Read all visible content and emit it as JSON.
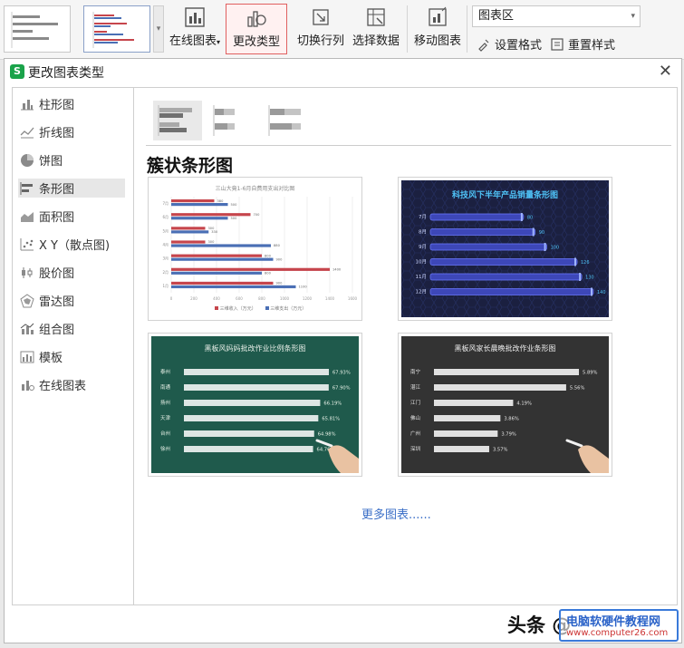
{
  "ribbon": {
    "online_chart": "在线图表",
    "change_type": "更改类型",
    "switch_row_col": "切换行列",
    "select_data": "选择数据",
    "move_chart": "移动图表",
    "chart_area_value": "图表区",
    "set_format": "设置格式",
    "reset_style": "重置样式",
    "dropdown_arrow": "▾"
  },
  "dialog": {
    "title": "更改图表类型",
    "close": "✕",
    "sidebar": [
      {
        "label": "柱形图",
        "icon": "column-chart-icon"
      },
      {
        "label": "折线图",
        "icon": "line-chart-icon"
      },
      {
        "label": "饼图",
        "icon": "pie-chart-icon"
      },
      {
        "label": "条形图",
        "icon": "bar-chart-icon"
      },
      {
        "label": "面积图",
        "icon": "area-chart-icon"
      },
      {
        "label": "X Y（散点图)",
        "icon": "scatter-chart-icon"
      },
      {
        "label": "股价图",
        "icon": "stock-chart-icon"
      },
      {
        "label": "雷达图",
        "icon": "radar-chart-icon"
      },
      {
        "label": "组合图",
        "icon": "combo-chart-icon"
      },
      {
        "label": "模板",
        "icon": "template-icon"
      },
      {
        "label": "在线图表",
        "icon": "online-chart-icon"
      }
    ],
    "selected_index": 3,
    "section_title": "簇状条形图",
    "more_charts": "更多图表......",
    "templates": [
      {
        "title": "三山大竟1-6月自费用支出对比图",
        "categories": [
          "1月",
          "2月",
          "3月",
          "4月",
          "5月",
          "6月",
          "7月"
        ],
        "series": [
          {
            "name": "三维收入（万元）",
            "color": "#c6454c",
            "values": [
              900,
              1400,
              800,
              300,
              300,
              700,
              380
            ]
          },
          {
            "name": "三维支出（万元）",
            "color": "#4a6fb5",
            "values": [
              1100,
              800,
              900,
              880,
              330,
              500,
              500
            ]
          }
        ],
        "ticks": [
          "0",
          "200",
          "400",
          "600",
          "800",
          "1000",
          "1200",
          "1400",
          "1600"
        ]
      },
      {
        "title": "科技风下半年产品销量条形图",
        "categories": [
          "7月",
          "8月",
          "9月",
          "10月",
          "11月",
          "12月"
        ],
        "values": [
          80,
          90,
          100,
          126,
          130,
          140
        ]
      },
      {
        "title": "黑板风妈妈批改作业比例条形图",
        "categories": [
          "泰州",
          "南通",
          "扬州",
          "天津",
          "台州",
          "徐州"
        ],
        "values": [
          "67.93%",
          "67.90%",
          "66.19%",
          "65.81%",
          "64.98%",
          "64.76%"
        ],
        "numeric": [
          67.93,
          67.9,
          66.19,
          65.81,
          64.98,
          64.76
        ]
      },
      {
        "title": "黑板风家长晨晚批改作业条形图",
        "categories": [
          "南宁",
          "湛江",
          "江门",
          "佛山",
          "广州",
          "深圳"
        ],
        "values": [
          "5.89%",
          "5.56%",
          "4.19%",
          "3.86%",
          "3.79%",
          "3.57%"
        ],
        "numeric": [
          5.89,
          5.56,
          4.19,
          3.86,
          3.79,
          3.57
        ]
      }
    ]
  },
  "watermark": {
    "text": "头条 @",
    "site_name": "电脑软硬件教程网",
    "site_url": "www.computer26.com"
  }
}
